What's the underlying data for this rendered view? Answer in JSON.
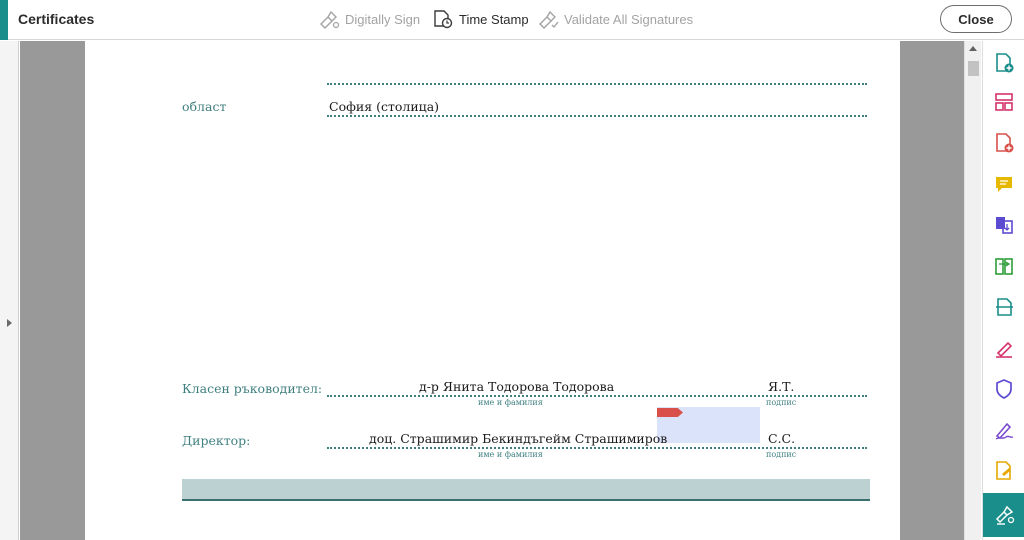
{
  "header": {
    "title": "Certificates",
    "tools": [
      {
        "label": "Digitally Sign",
        "enabled": false,
        "icon": "pen-sign-icon"
      },
      {
        "label": "Time Stamp",
        "enabled": true,
        "icon": "time-stamp-icon"
      },
      {
        "label": "Validate All Signatures",
        "enabled": false,
        "icon": "validate-signature-icon"
      }
    ],
    "close_label": "Close",
    "accent_color": "#1a8e8a"
  },
  "document": {
    "region_label": "област",
    "region_value": "София (столица)",
    "teacher": {
      "label": "Класен ръководител:",
      "name": "д-р Янита Тодорова Тодорова",
      "initials": "Я.Т.",
      "name_caption": "име и фамилия",
      "sign_caption": "подпис"
    },
    "director": {
      "label": "Директор:",
      "name": "доц. Страшимир Бекиндъгейм Страшимиров",
      "initials": "С.С.",
      "name_caption": "име и фамилия",
      "sign_caption": "подпис"
    }
  },
  "right_rail": {
    "tools": [
      {
        "icon": "create-pdf-icon",
        "color": "#1a8e8a"
      },
      {
        "icon": "organize-pages-icon",
        "color": "#d6336c"
      },
      {
        "icon": "export-pdf-icon",
        "color": "#d9504a"
      },
      {
        "icon": "comment-icon",
        "color": "#e6b800"
      },
      {
        "icon": "combine-files-icon",
        "color": "#5b4bd0"
      },
      {
        "icon": "compare-files-icon",
        "color": "#2e9e3a"
      },
      {
        "icon": "scan-ocr-icon",
        "color": "#1a8e8a"
      },
      {
        "icon": "fill-sign-icon",
        "color": "#d6336c"
      },
      {
        "icon": "protect-icon",
        "color": "#5b4bd0"
      },
      {
        "icon": "request-signature-icon",
        "color": "#7a4bd0"
      },
      {
        "icon": "prepare-form-icon",
        "color": "#e6a800"
      },
      {
        "icon": "certificates-icon",
        "color": "#ffffff",
        "active": true
      }
    ]
  }
}
